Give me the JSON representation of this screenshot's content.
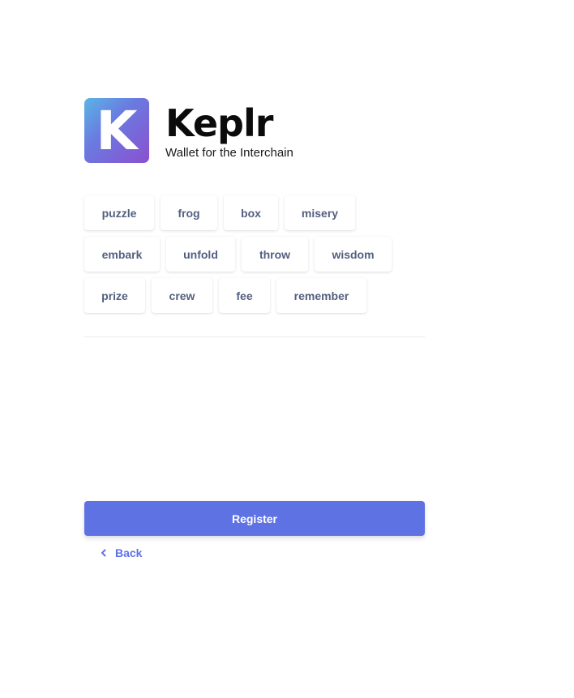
{
  "brand": {
    "logo_letter": "K",
    "name": "Keplr",
    "tagline": "Wallet for the Interchain"
  },
  "mnemonic": {
    "words": [
      "puzzle",
      "frog",
      "box",
      "misery",
      "embark",
      "unfold",
      "throw",
      "wisdom",
      "prize",
      "crew",
      "fee",
      "remember"
    ]
  },
  "actions": {
    "register_label": "Register",
    "back_label": "Back"
  },
  "colors": {
    "accent": "#5e72e4",
    "word_text": "#525f7f"
  }
}
